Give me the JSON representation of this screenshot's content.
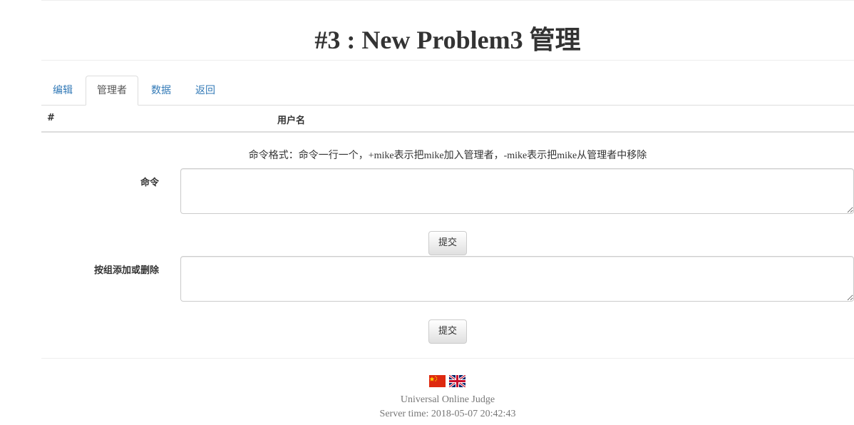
{
  "header": {
    "title": "#3 : New Problem3 管理"
  },
  "tabs": [
    {
      "label": "编辑",
      "active": false
    },
    {
      "label": "管理者",
      "active": true
    },
    {
      "label": "数据",
      "active": false
    },
    {
      "label": "返回",
      "active": false
    }
  ],
  "table": {
    "columns": [
      "#",
      "用户名"
    ]
  },
  "form": {
    "hint": "命令格式：命令一行一个，+mike表示把mike加入管理者，-mike表示把mike从管理者中移除",
    "command_label": "命令",
    "command_value": "",
    "group_label": "按组添加或删除",
    "group_value": "",
    "submit_label": "提交"
  },
  "footer": {
    "site_name": "Universal Online Judge",
    "server_time": "Server time: 2018-05-07 20:42:43",
    "flags": [
      "china-flag-icon",
      "uk-flag-icon"
    ]
  },
  "colors": {
    "link": "#337ab7",
    "muted": "#777777",
    "border": "#dddddd",
    "flag_red": "#de2910",
    "flag_yellow": "#ffde00",
    "uk_blue": "#012169",
    "uk_red": "#c8102e"
  }
}
